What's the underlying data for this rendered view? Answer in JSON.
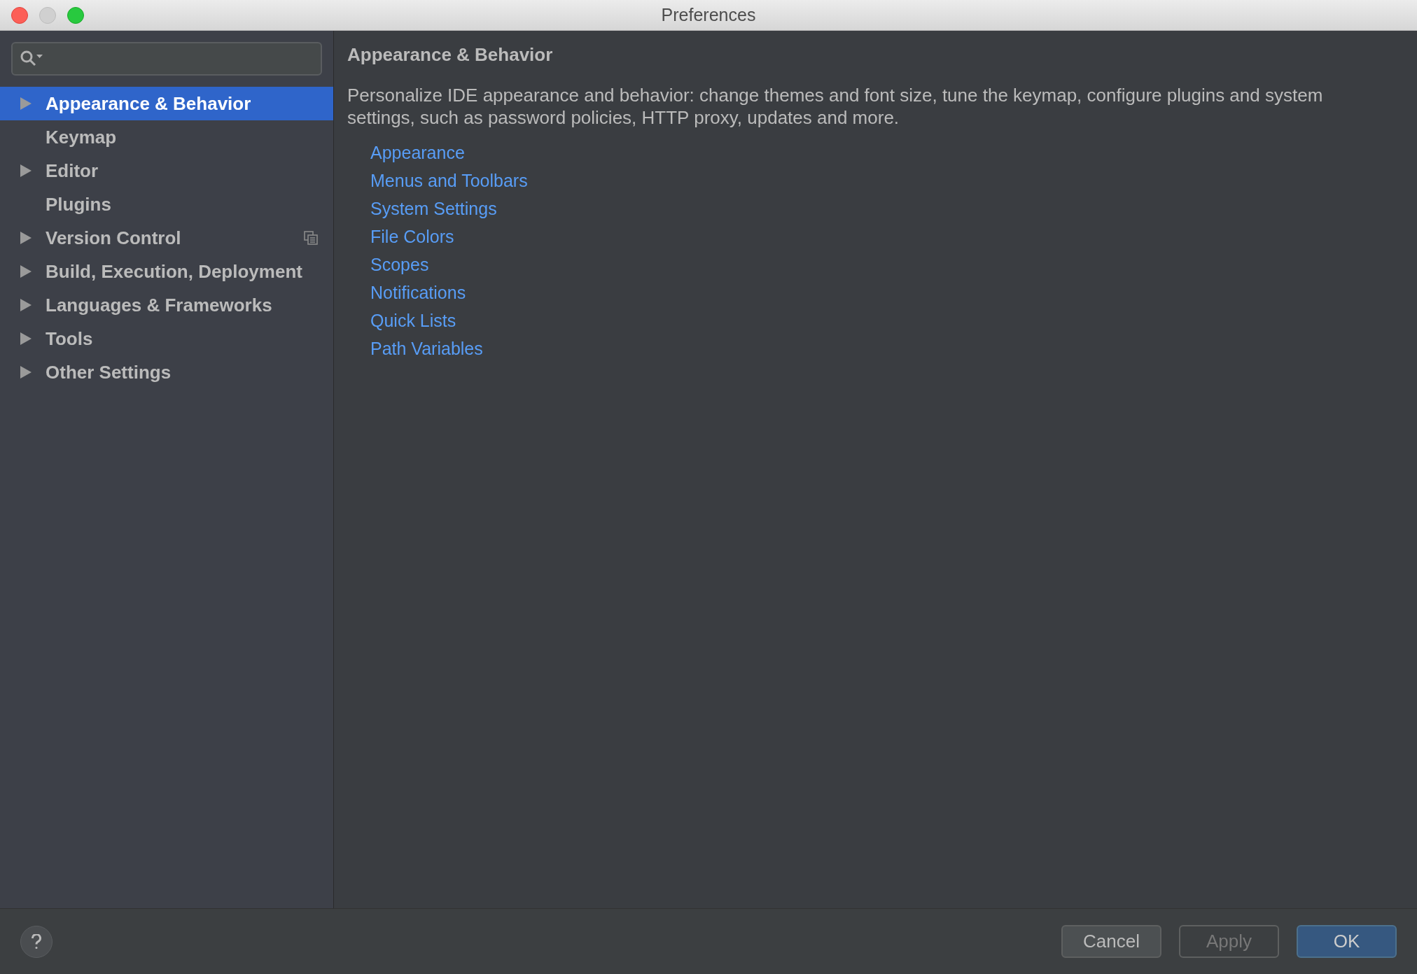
{
  "window": {
    "title": "Preferences"
  },
  "sidebar": {
    "items": [
      {
        "label": "Appearance & Behavior",
        "expandable": true,
        "selected": true,
        "project_icon": false
      },
      {
        "label": "Keymap",
        "expandable": false,
        "selected": false,
        "project_icon": false
      },
      {
        "label": "Editor",
        "expandable": true,
        "selected": false,
        "project_icon": false
      },
      {
        "label": "Plugins",
        "expandable": false,
        "selected": false,
        "project_icon": false
      },
      {
        "label": "Version Control",
        "expandable": true,
        "selected": false,
        "project_icon": true
      },
      {
        "label": "Build, Execution, Deployment",
        "expandable": true,
        "selected": false,
        "project_icon": false
      },
      {
        "label": "Languages & Frameworks",
        "expandable": true,
        "selected": false,
        "project_icon": false
      },
      {
        "label": "Tools",
        "expandable": true,
        "selected": false,
        "project_icon": false
      },
      {
        "label": "Other Settings",
        "expandable": true,
        "selected": false,
        "project_icon": false
      }
    ]
  },
  "content": {
    "heading": "Appearance & Behavior",
    "description": "Personalize IDE appearance and behavior: change themes and font size, tune the keymap, configure plugins and system settings, such as password policies, HTTP proxy, updates and more.",
    "links": [
      "Appearance",
      "Menus and Toolbars",
      "System Settings",
      "File Colors",
      "Scopes",
      "Notifications",
      "Quick Lists",
      "Path Variables"
    ]
  },
  "buttons": [
    {
      "label": "Cancel",
      "kind": "normal"
    },
    {
      "label": "Apply",
      "kind": "disabled"
    },
    {
      "label": "OK",
      "kind": "default"
    }
  ]
}
